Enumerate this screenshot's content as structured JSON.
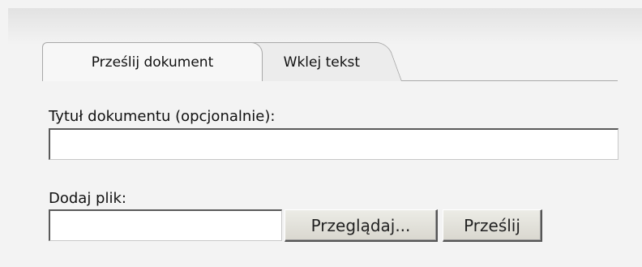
{
  "tabs": [
    {
      "label": "Prześlij dokument",
      "active": true
    },
    {
      "label": "Wklej tekst",
      "active": false
    }
  ],
  "title_field": {
    "label": "Tytuł dokumentu (opcjonalnie):",
    "value": ""
  },
  "file_field": {
    "label": "Dodaj plik:",
    "value": "",
    "browse_label": "Przeglądaj...",
    "upload_label": "Prześlij"
  }
}
